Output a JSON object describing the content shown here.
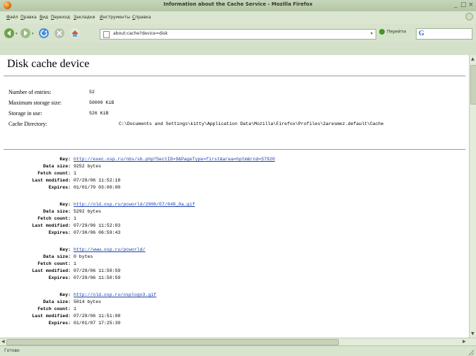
{
  "window": {
    "title": "Information about the Cache Service - Mozilla Firefox"
  },
  "menu": [
    "Файл",
    "Правка",
    "Вид",
    "Переход",
    "Закладки",
    "Инструменты",
    "Справка"
  ],
  "nav": {
    "url": "about:cache?device=disk",
    "go_label": "Перейти",
    "search_logo": "G"
  },
  "page": {
    "heading": "Disk cache device",
    "info": [
      {
        "label": "Number of entries:",
        "value": "52"
      },
      {
        "label": "Maximum storage size:",
        "value": "50000 KiB"
      },
      {
        "label": "Storage in use:",
        "value": "526 KiB"
      },
      {
        "label": "Cache Directory:",
        "value": "C:\\Documents and Settings\\kitty\\Application Data\\Mozilla\\Firefox\\Profiles\\2aresmez.default\\Cache"
      }
    ],
    "labels": {
      "key": "Key:",
      "size": "Data size:",
      "fetch": "Fetch count:",
      "modified": "Last modified:",
      "expires": "Expires:"
    },
    "entries": [
      {
        "key": "http://exec.osp.ru/nbs/sb.php?SectID=9&PageType=first&area=hptm&rnd=57920",
        "size": "9252 bytes",
        "fetch": "1",
        "modified": "07/29/06 11:52:18",
        "expires": "01/01/70 03:00:00"
      },
      {
        "key": "http://old.osp.ru/pcworld/2006/07/048_0a.gif",
        "size": "5292 bytes",
        "fetch": "1",
        "modified": "07/29/06 11:52:03",
        "expires": "07/30/06 06:59:43"
      },
      {
        "key": "http://www.osp.ru/pcworld/",
        "size": "0 bytes",
        "fetch": "1",
        "modified": "07/29/06 11:50:59",
        "expires": "07/29/06 11:50:59"
      },
      {
        "key": "http://old.osp.ru/osplogo3.gif",
        "size": "5014 bytes",
        "fetch": "1",
        "modified": "07/29/06 11:51:08",
        "expires": "01/01/07 17:25:39"
      }
    ]
  },
  "status": {
    "text": "Готово"
  },
  "icons": [
    "back-arrow-icon",
    "forward-arrow-icon",
    "reload-icon",
    "stop-icon",
    "home-icon",
    "page-icon",
    "go-icon",
    "search-engine-icon"
  ]
}
